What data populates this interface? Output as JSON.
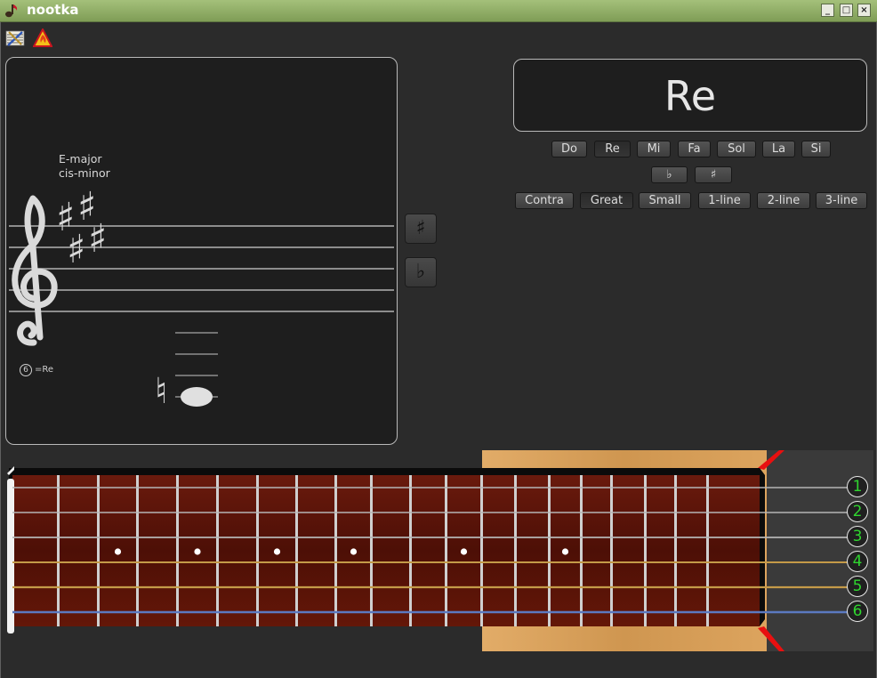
{
  "window": {
    "title": "nootka"
  },
  "toolbar": {
    "settings_icon": "settings-icon",
    "exam_icon": "exam-start-icon"
  },
  "score": {
    "key_major": "E-major",
    "key_minor": "cis-minor",
    "tuning_string": "6",
    "tuning_note": "=Re",
    "sharp_symbol": "♯",
    "flat_symbol": "♭",
    "natural_symbol": "♮"
  },
  "side_buttons": {
    "sharp": "♯",
    "flat": "♭"
  },
  "note_name": {
    "display": "Re",
    "notes": [
      "Do",
      "Re",
      "Mi",
      "Fa",
      "Sol",
      "La",
      "Si"
    ],
    "selected_note": "Re",
    "accidentals": [
      "♭",
      "♯"
    ],
    "octaves": [
      "Contra",
      "Great",
      "Small",
      "1-line",
      "2-line",
      "3-line"
    ],
    "selected_octave": "Great"
  },
  "guitar": {
    "frets": 19,
    "fret_markers": [
      3,
      5,
      7,
      9,
      12,
      15
    ],
    "strings": [
      "1",
      "2",
      "3",
      "4",
      "5",
      "6"
    ],
    "string_label_color": "#2fd52f",
    "fingerboard_color": "#5a1208",
    "body_color": "#d9a05c",
    "accent_color": "#e81010"
  }
}
